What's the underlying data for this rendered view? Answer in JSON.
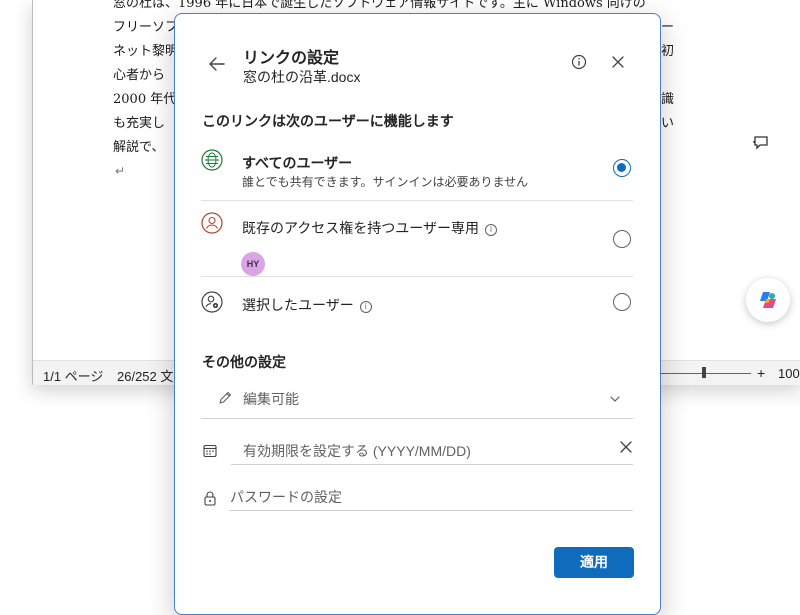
{
  "document": {
    "lines": [
      "窓の杜は、1996 年に日本で誕生したソフトウェア情報サイトです。主に Windows 向けの",
      "フリーソフ",
      "ネット黎明",
      "心者から",
      "2000 年代",
      "も充実し",
      "解説で、"
    ],
    "line_tails": [
      "",
      "ー",
      "初",
      "",
      "識",
      "い",
      ""
    ]
  },
  "status_bar": {
    "page": "1/1 ページ",
    "word_count": "26/252 文",
    "zoom": "100"
  },
  "dialog": {
    "title": "リンクの設定",
    "filename": "窓の杜の沿革.docx",
    "applies_heading": "このリンクは次のユーザーに機能します",
    "options": [
      {
        "label": "すべてのユーザー",
        "description": "誰とでも共有できます。サインインは必要ありません",
        "selected": true,
        "icon": "globe-icon"
      },
      {
        "label": "既存のアクセス権を持つユーザー専用",
        "avatar": "HY",
        "selected": false,
        "icon": "person-icon"
      },
      {
        "label": "選択したユーザー",
        "selected": false,
        "icon": "people-settings-icon"
      }
    ],
    "other_settings_heading": "その他の設定",
    "permission": "編集可能",
    "expiry_placeholder": "有効期限を設定する (YYYY/MM/DD)",
    "password_label": "パスワードの設定",
    "apply_label": "適用"
  },
  "colors": {
    "accent": "#0f6cbd",
    "dialog_border": "#4a7fc1",
    "avatar_bg": "#d9a6e3",
    "globe_icon": "#1b7a3a"
  }
}
